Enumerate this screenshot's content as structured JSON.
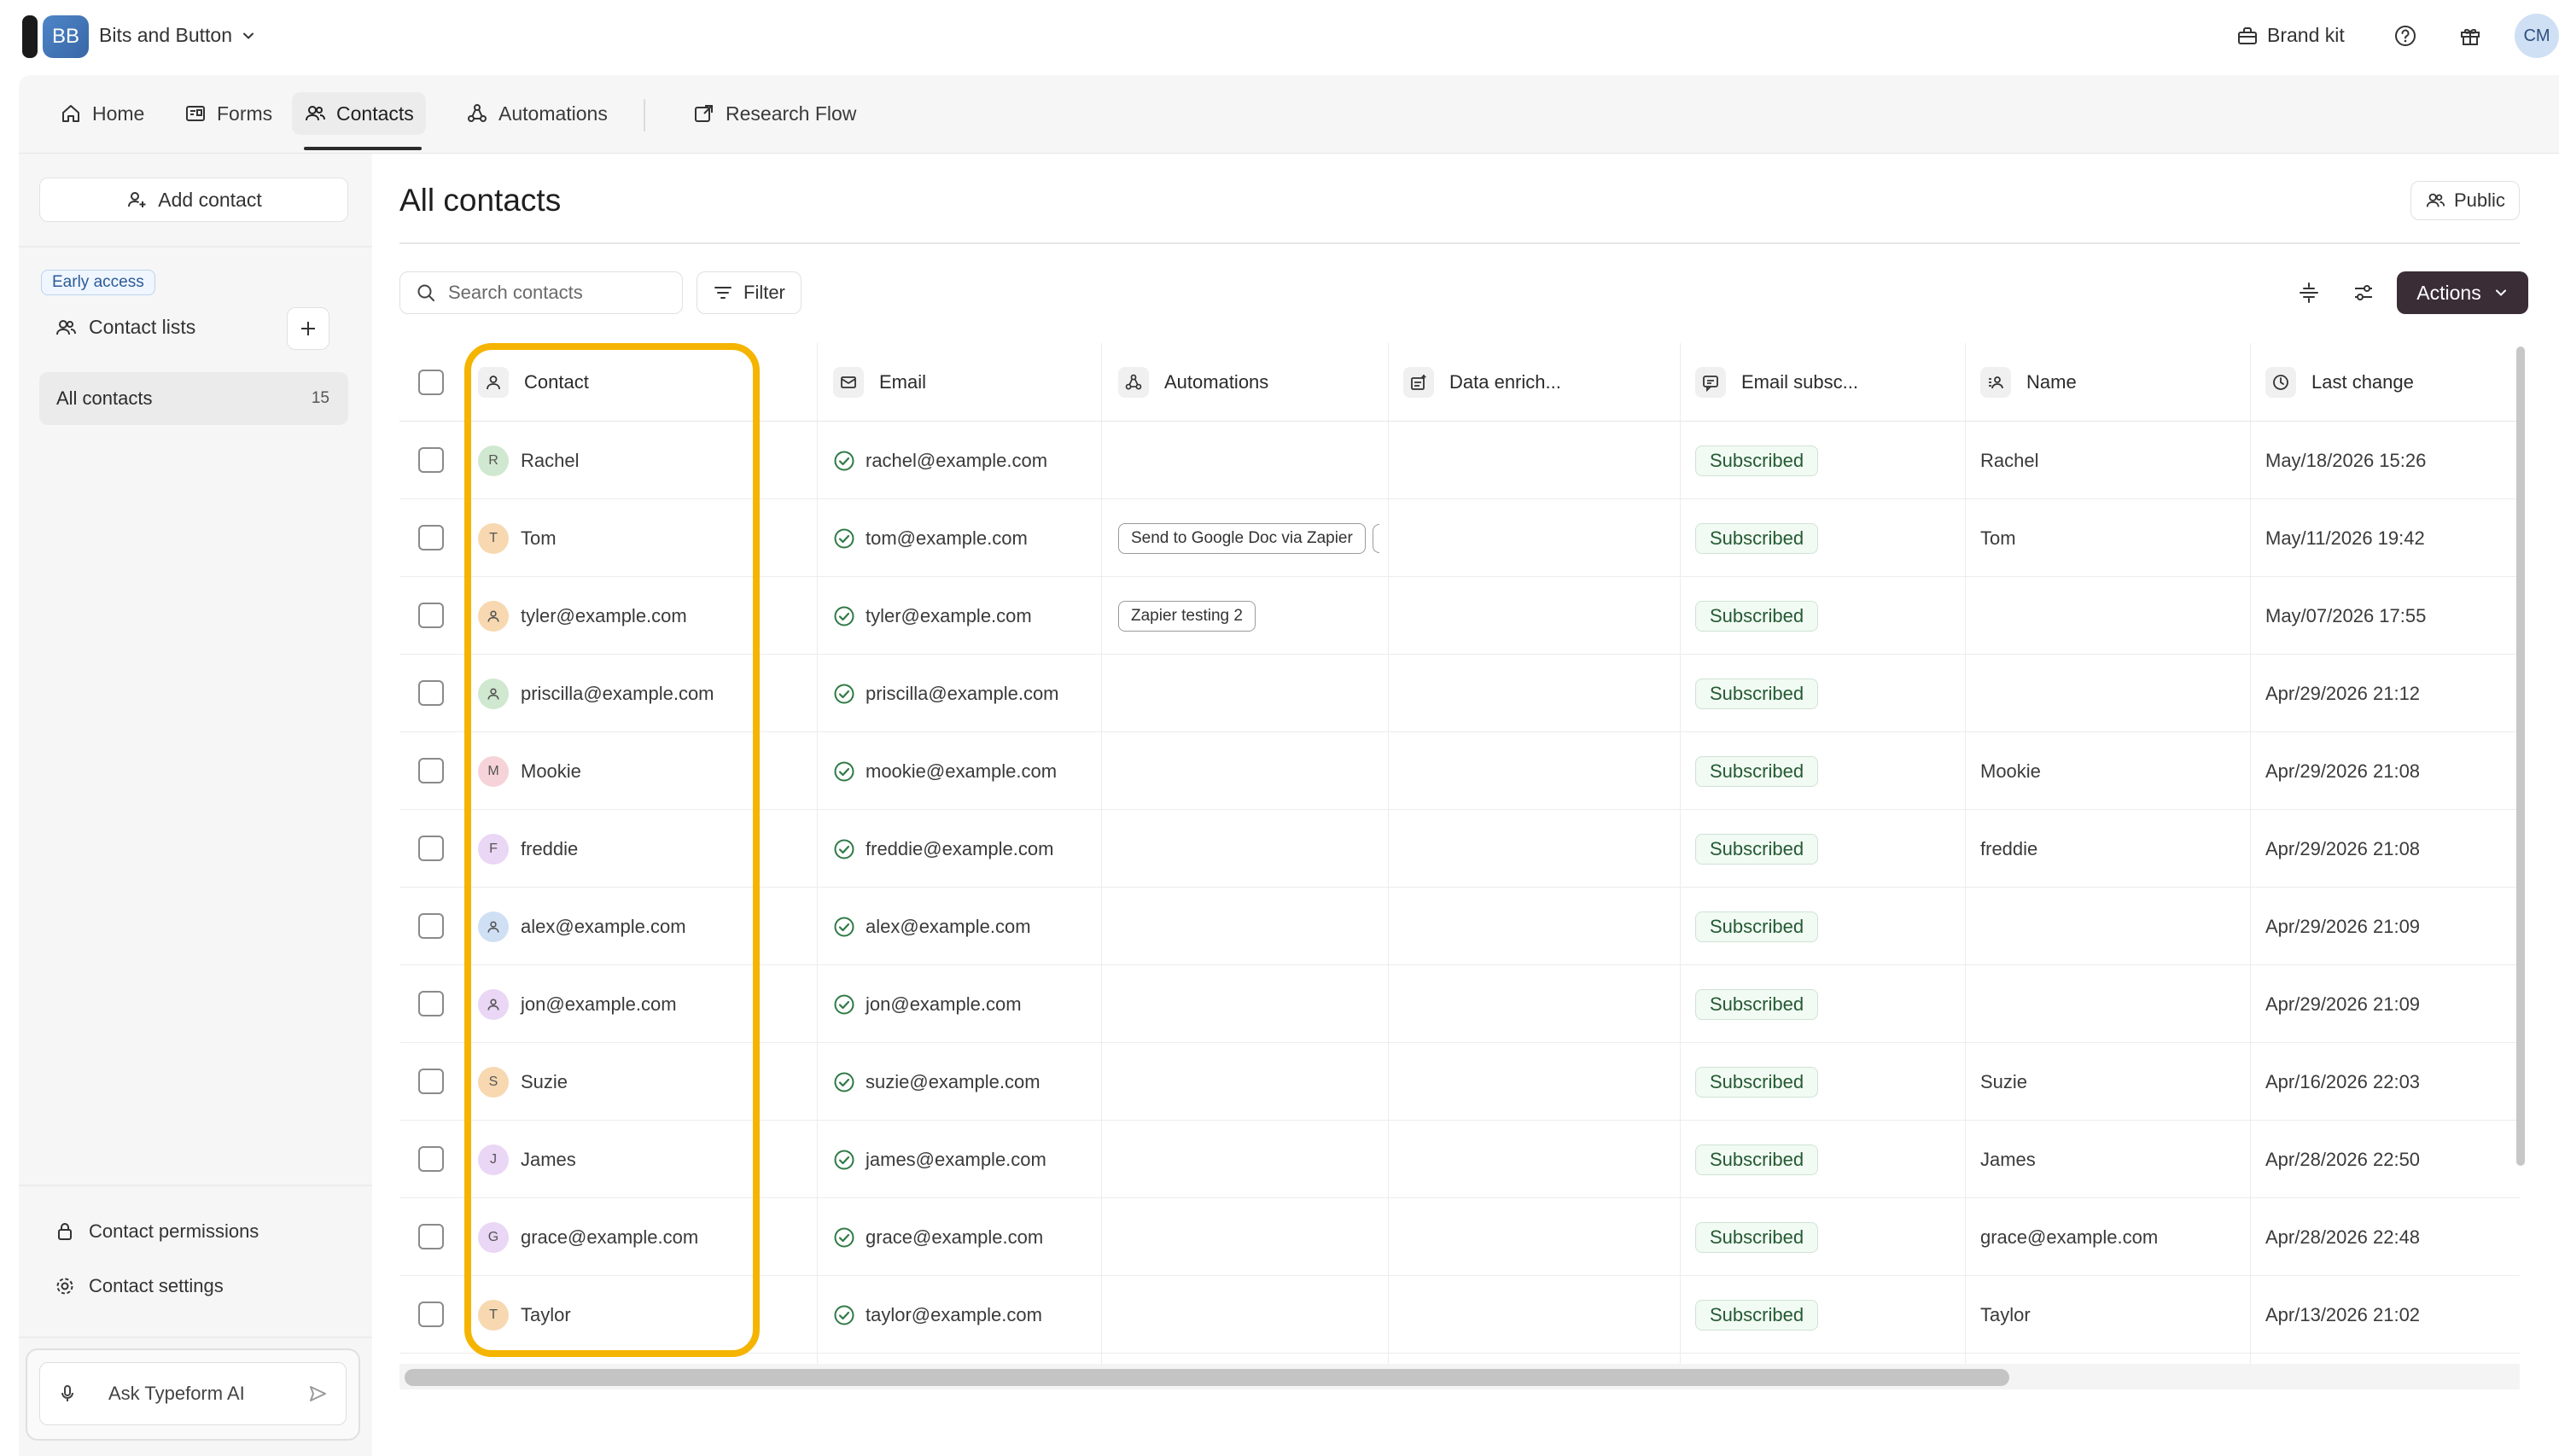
{
  "workspace": {
    "initials": "BB",
    "name": "Bits and Button"
  },
  "topbar": {
    "brand_kit": "Brand kit",
    "user_initials": "CM"
  },
  "nav": {
    "tabs": [
      {
        "label": "Home"
      },
      {
        "label": "Forms"
      },
      {
        "label": "Contacts"
      },
      {
        "label": "Automations"
      },
      {
        "label": "Research Flow"
      }
    ],
    "active": "Contacts"
  },
  "sidebar": {
    "add_contact": "Add contact",
    "early_access": "Early access",
    "contact_lists": "Contact lists",
    "all_contacts": "All contacts",
    "all_contacts_count": "15",
    "contact_permissions": "Contact permissions",
    "contact_settings": "Contact settings",
    "ask_ai": "Ask Typeform AI"
  },
  "main": {
    "title": "All contacts",
    "public_label": "Public",
    "search_placeholder": "Search contacts",
    "filter_label": "Filter",
    "actions_label": "Actions"
  },
  "table": {
    "columns": [
      "Contact",
      "Email",
      "Automations",
      "Data enrich...",
      "Email subsc...",
      "Name",
      "Last change"
    ],
    "rows": [
      {
        "initial": "R",
        "avatar_color": "#cfe8cf",
        "contact": "Rachel",
        "email": "rachel@example.com",
        "automation": "",
        "chip_cut": false,
        "status": "Subscribed",
        "name": "Rachel",
        "last_change": "May/18/2026 15:26"
      },
      {
        "initial": "T",
        "avatar_color": "#f7d8b0",
        "contact": "Tom",
        "email": "tom@example.com",
        "automation": "Send to Google Doc via Zapier",
        "chip_cut": true,
        "status": "Subscribed",
        "name": "Tom",
        "last_change": "May/11/2026 19:42"
      },
      {
        "initial": "",
        "avatar_color": "#f7d8b0",
        "contact": "tyler@example.com",
        "email": "tyler@example.com",
        "automation": "Zapier testing 2",
        "chip_cut": false,
        "status": "Subscribed",
        "name": "",
        "last_change": "May/07/2026 17:55"
      },
      {
        "initial": "",
        "avatar_color": "#cfe8cf",
        "contact": "priscilla@example.com",
        "email": "priscilla@example.com",
        "automation": "",
        "chip_cut": false,
        "status": "Subscribed",
        "name": "",
        "last_change": "Apr/29/2026 21:12"
      },
      {
        "initial": "M",
        "avatar_color": "#f6d3d8",
        "contact": "Mookie",
        "email": "mookie@example.com",
        "automation": "",
        "chip_cut": false,
        "status": "Subscribed",
        "name": "Mookie",
        "last_change": "Apr/29/2026 21:08"
      },
      {
        "initial": "F",
        "avatar_color": "#ead6f5",
        "contact": "freddie",
        "email": "freddie@example.com",
        "automation": "",
        "chip_cut": false,
        "status": "Subscribed",
        "name": "freddie",
        "last_change": "Apr/29/2026 21:08"
      },
      {
        "initial": "",
        "avatar_color": "#cfe0f5",
        "contact": "alex@example.com",
        "email": "alex@example.com",
        "automation": "",
        "chip_cut": false,
        "status": "Subscribed",
        "name": "",
        "last_change": "Apr/29/2026 21:09"
      },
      {
        "initial": "",
        "avatar_color": "#ead6f5",
        "contact": "jon@example.com",
        "email": "jon@example.com",
        "automation": "",
        "chip_cut": false,
        "status": "Subscribed",
        "name": "",
        "last_change": "Apr/29/2026 21:09"
      },
      {
        "initial": "S",
        "avatar_color": "#f7d8b0",
        "contact": "Suzie",
        "email": "suzie@example.com",
        "automation": "",
        "chip_cut": false,
        "status": "Subscribed",
        "name": "Suzie",
        "last_change": "Apr/16/2026 22:03"
      },
      {
        "initial": "J",
        "avatar_color": "#ead6f5",
        "contact": "James",
        "email": "james@example.com",
        "automation": "",
        "chip_cut": false,
        "status": "Subscribed",
        "name": "James",
        "last_change": "Apr/28/2026 22:50"
      },
      {
        "initial": "G",
        "avatar_color": "#ead6f5",
        "contact": "grace@example.com",
        "email": "grace@example.com",
        "automation": "",
        "chip_cut": false,
        "status": "Subscribed",
        "name": "grace@example.com",
        "last_change": "Apr/28/2026 22:48"
      },
      {
        "initial": "T",
        "avatar_color": "#f7d8b0",
        "contact": "Taylor",
        "email": "taylor@example.com",
        "automation": "",
        "chip_cut": false,
        "status": "Subscribed",
        "name": "Taylor",
        "last_change": "Apr/13/2026 21:02"
      }
    ]
  },
  "colors": {
    "accent_dark": "#3a2d36",
    "highlight": "#f5b400",
    "subscribed_text": "#245a33",
    "check_green": "#2f7a45"
  }
}
